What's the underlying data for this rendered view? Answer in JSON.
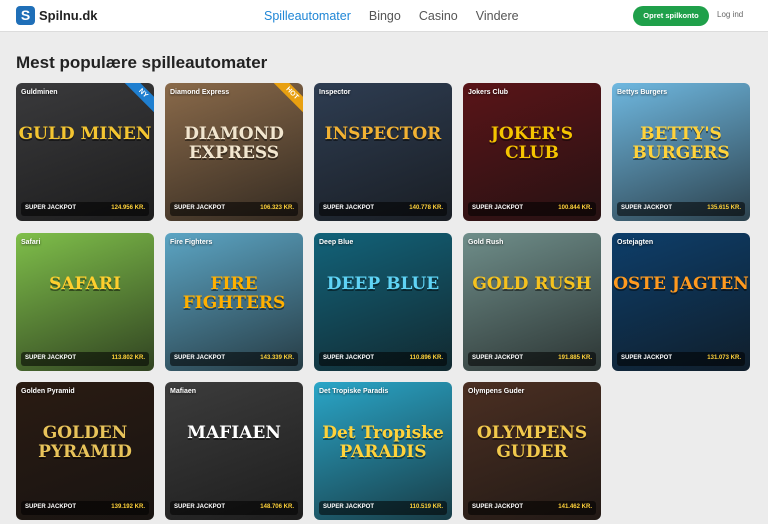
{
  "header": {
    "logo_icon": "S",
    "logo_text": "Spilnu.dk",
    "nav": [
      {
        "label": "Spilleautomater",
        "active": true
      },
      {
        "label": "Bingo",
        "active": false
      },
      {
        "label": "Casino",
        "active": false
      },
      {
        "label": "Vindere",
        "active": false
      }
    ],
    "signup_label": "Opret spilkonto",
    "login_label": "Log ind"
  },
  "main": {
    "title": "Mest populære spilleautomater"
  },
  "games": [
    {
      "name": "Guldminen",
      "art": "GULD MINEN",
      "jackpot_label": "SUPER JACKPOT",
      "jackpot": "124.956 KR.",
      "badge": "NY",
      "badge_color": "#1f7fd0",
      "bg": "#3a3a3c",
      "art_color": "#f4c531"
    },
    {
      "name": "Diamond Express",
      "art": "DIAMOND EXPRESS",
      "jackpot_label": "SUPER JACKPOT",
      "jackpot": "106.323 KR.",
      "badge": "HOT",
      "badge_color": "#e8a011",
      "bg": "#8a6a4a",
      "art_color": "#f2e6cf"
    },
    {
      "name": "Inspector",
      "art": "INSPECTOR",
      "jackpot_label": "SUPER JACKPOT",
      "jackpot": "140.778 KR.",
      "badge": "",
      "badge_color": "",
      "bg": "#2e3d52",
      "art_color": "#f2b233"
    },
    {
      "name": "Jokers Club",
      "art": "JOKER'S CLUB",
      "jackpot_label": "SUPER JACKPOT",
      "jackpot": "100.844 KR.",
      "badge": "",
      "badge_color": "",
      "bg": "#5a1418",
      "art_color": "#f5c400"
    },
    {
      "name": "Bettys Burgers",
      "art": "BETTY'S BURGERS",
      "jackpot_label": "SUPER JACKPOT",
      "jackpot": "135.615 KR.",
      "badge": "",
      "badge_color": "",
      "bg": "#6fb8e0",
      "art_color": "#ffd23a"
    },
    {
      "name": "Safari",
      "art": "SAFARI",
      "jackpot_label": "SUPER JACKPOT",
      "jackpot": "113.802 KR.",
      "badge": "",
      "badge_color": "",
      "bg": "#7fbf4a",
      "art_color": "#ffcf2e"
    },
    {
      "name": "Fire Fighters",
      "art": "FIRE FIGHTERS",
      "jackpot_label": "SUPER JACKPOT",
      "jackpot": "143.339 KR.",
      "badge": "",
      "badge_color": "",
      "bg": "#5ca5c4",
      "art_color": "#ffb000"
    },
    {
      "name": "Deep Blue",
      "art": "DEEP BLUE",
      "jackpot_label": "SUPER JACKPOT",
      "jackpot": "110.896 KR.",
      "badge": "",
      "badge_color": "",
      "bg": "#12637a",
      "art_color": "#5fd3f5"
    },
    {
      "name": "Gold Rush",
      "art": "GOLD RUSH",
      "jackpot_label": "SUPER JACKPOT",
      "jackpot": "191.885 KR.",
      "badge": "",
      "badge_color": "",
      "bg": "#6f8e8a",
      "art_color": "#f5c21f"
    },
    {
      "name": "Ostejagten",
      "art": "OSTE JAGTEN",
      "jackpot_label": "SUPER JACKPOT",
      "jackpot": "131.073 KR.",
      "badge": "",
      "badge_color": "",
      "bg": "#0d3e6a",
      "art_color": "#ff9a1f"
    },
    {
      "name": "Golden Pyramid",
      "art": "GOLDEN PYRAMID",
      "jackpot_label": "SUPER JACKPOT",
      "jackpot": "139.192 KR.",
      "badge": "",
      "badge_color": "",
      "bg": "#2a1b12",
      "art_color": "#e8c35a"
    },
    {
      "name": "Mafiaen",
      "art": "MAFIAEN",
      "jackpot_label": "SUPER JACKPOT",
      "jackpot": "148.706 KR.",
      "badge": "",
      "badge_color": "",
      "bg": "#3c3c3c",
      "art_color": "#ffffff"
    },
    {
      "name": "Det Tropiske Paradis",
      "art": "Det Tropiske PARADIS",
      "jackpot_label": "SUPER JACKPOT",
      "jackpot": "110.519 KR.",
      "badge": "",
      "badge_color": "",
      "bg": "#2aa6c8",
      "art_color": "#ffd23a"
    },
    {
      "name": "Olympens Guder",
      "art": "OLYMPENS GUDER",
      "jackpot_label": "SUPER JACKPOT",
      "jackpot": "141.462 KR.",
      "badge": "",
      "badge_color": "",
      "bg": "#4b2f22",
      "art_color": "#f2c94c"
    }
  ]
}
